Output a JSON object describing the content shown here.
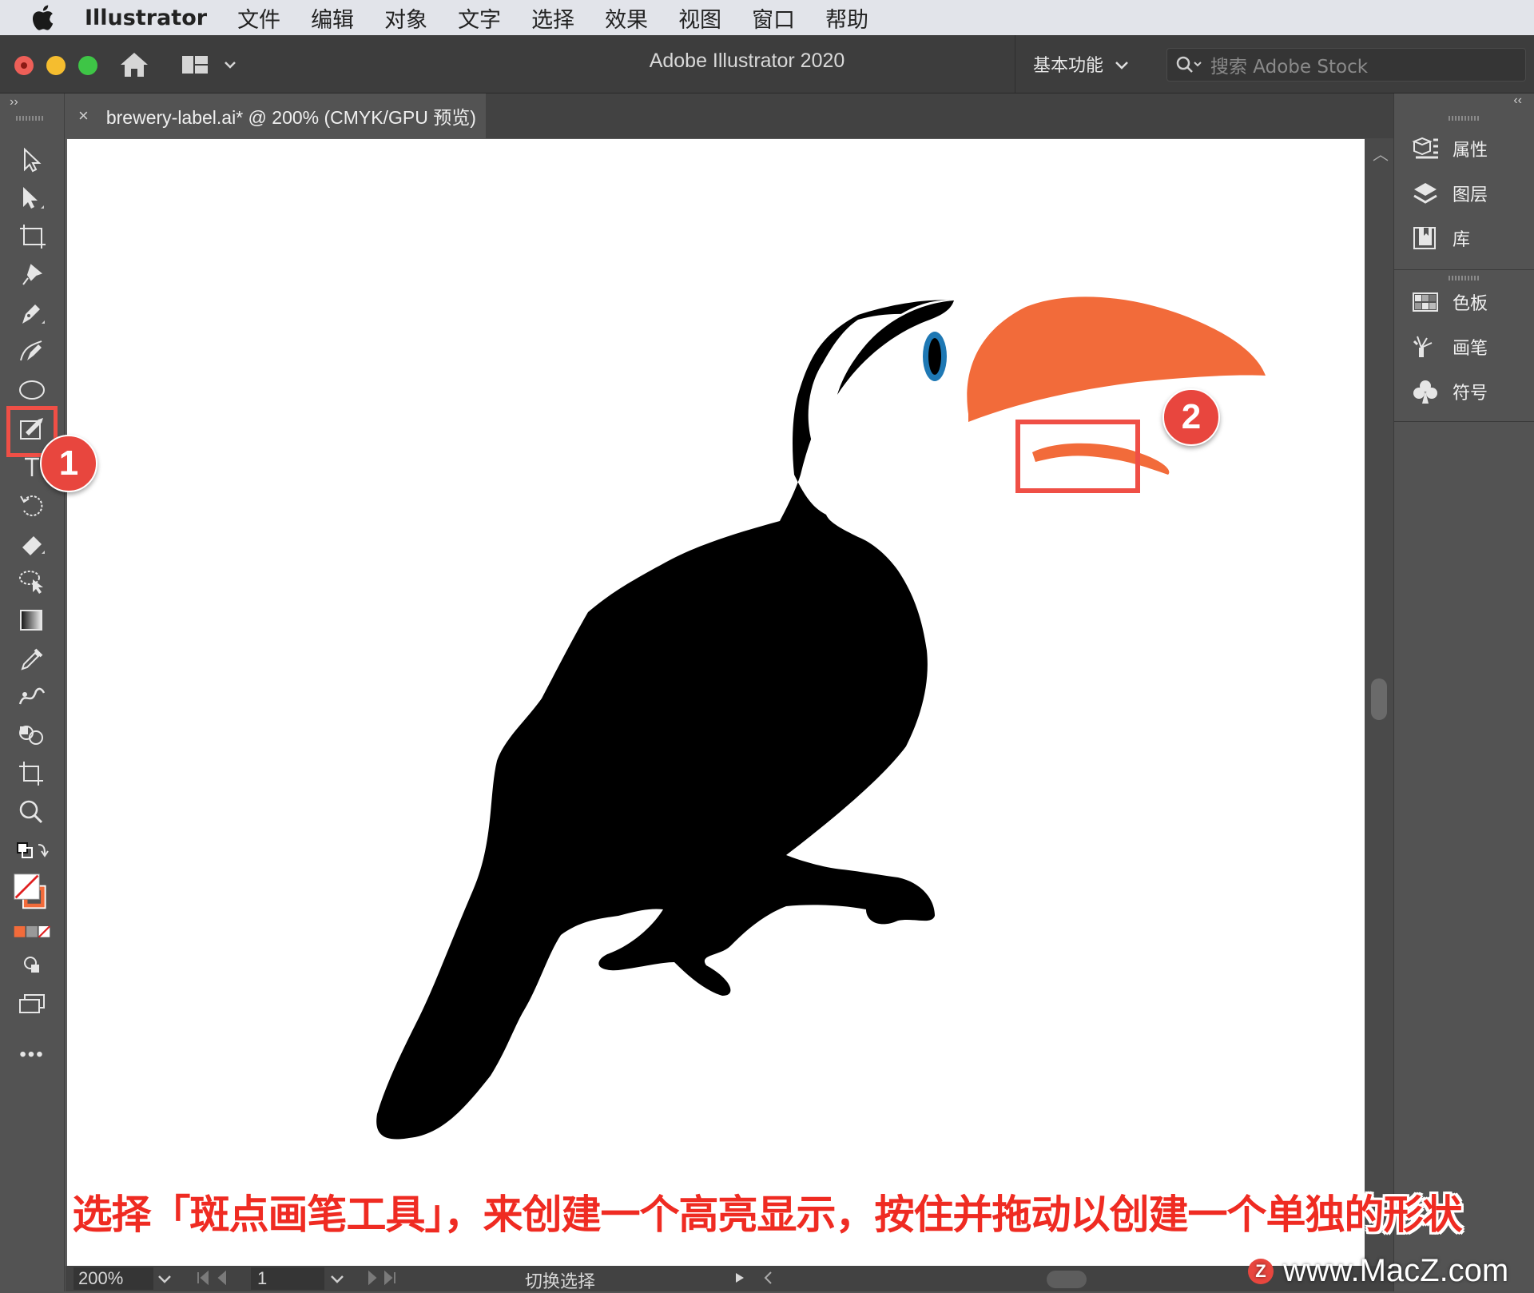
{
  "menubar": {
    "app_name": "Illustrator",
    "items": [
      "文件",
      "编辑",
      "对象",
      "文字",
      "选择",
      "效果",
      "视图",
      "窗口",
      "帮助"
    ]
  },
  "appbar": {
    "title": "Adobe Illustrator 2020",
    "workspace": "基本功能",
    "search_placeholder": "搜索 Adobe Stock"
  },
  "document": {
    "tab_close": "×",
    "tab_title": "brewery-label.ai* @ 200% (CMYK/GPU 预览)"
  },
  "toolbar": {
    "tools": [
      "selection-tool",
      "direct-selection-tool",
      "artboard-tool",
      "pin-tool",
      "pen-tool",
      "curvature-tool",
      "ellipse-tool",
      "blob-brush-tool",
      "type-tool",
      "rotate-tool",
      "eraser-tool",
      "lasso-tool",
      "gradient-tool",
      "eyedropper-tool",
      "puppet-warp-tool",
      "shape-builder-tool",
      "crop-tool",
      "zoom-tool"
    ],
    "more": "•••"
  },
  "annotations": {
    "badge1": "1",
    "badge2": "2"
  },
  "right_panel": {
    "group1": [
      "属性",
      "图层",
      "库"
    ],
    "group2": [
      "色板",
      "画笔",
      "符号"
    ]
  },
  "statusbar": {
    "zoom": "200%",
    "artboard": "1",
    "status": "切换选择"
  },
  "caption": "选择「斑点画笔工具」，来创建一个高亮显示，按住并拖动以创建一个单独的形状",
  "watermark": "www.MacZ.com",
  "colors": {
    "beak": "#f26b3a",
    "eye_ring": "#1e78b4",
    "annotation_red": "#e8463e"
  }
}
